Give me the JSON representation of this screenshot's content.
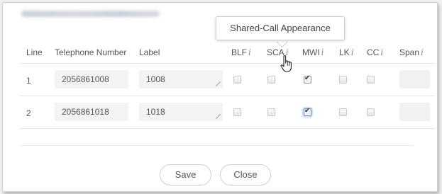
{
  "tooltip": {
    "text": "Shared-Call Appearance"
  },
  "columns": {
    "line": "Line",
    "telephone": "Telephone Number",
    "label": "Label",
    "blf": "BLF",
    "sca": "SCA",
    "mwi": "MWI",
    "lk": "LK",
    "cc": "CC",
    "span": "Span",
    "info_glyph": "i"
  },
  "rows": [
    {
      "line": "1",
      "telephone": "2056861008",
      "label": "1008",
      "blf": false,
      "sca": false,
      "mwi": true,
      "lk": false,
      "cc": false
    },
    {
      "line": "2",
      "telephone": "2056861018",
      "label": "1018",
      "blf": false,
      "sca": false,
      "mwi": true,
      "lk": false,
      "cc": false
    }
  ],
  "buttons": {
    "save": "Save",
    "close": "Close"
  }
}
